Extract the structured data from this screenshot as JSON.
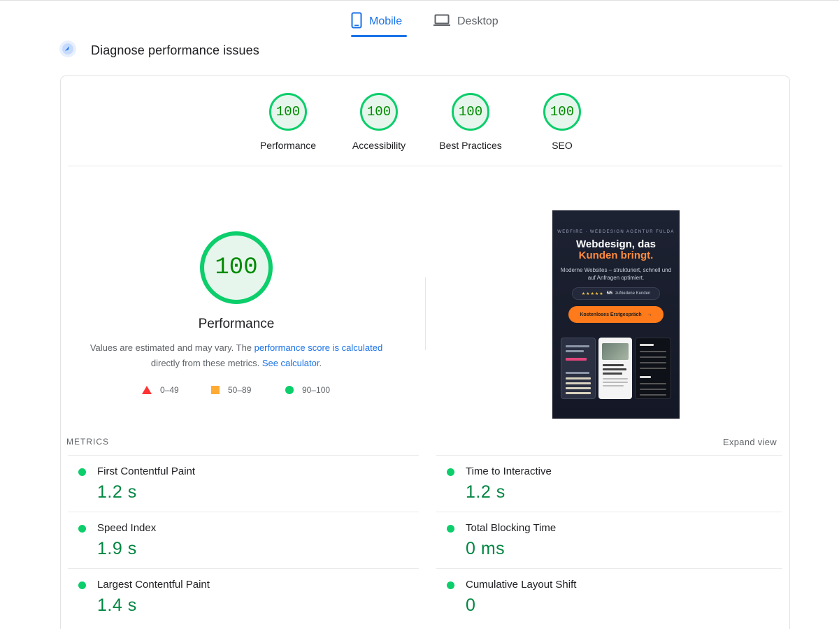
{
  "tabs": [
    {
      "label": "Mobile",
      "icon": "smartphone-icon",
      "active": true
    },
    {
      "label": "Desktop",
      "icon": "laptop-icon",
      "active": false
    }
  ],
  "header": {
    "title": "Diagnose performance issues",
    "icon": "diagnose-icon"
  },
  "gauges": [
    {
      "score": "100",
      "label": "Performance"
    },
    {
      "score": "100",
      "label": "Accessibility"
    },
    {
      "score": "100",
      "label": "Best Practices"
    },
    {
      "score": "100",
      "label": "SEO"
    }
  ],
  "performance": {
    "score": "100",
    "label": "Performance",
    "note_1": "Values are estimated and may vary. The ",
    "note_link_1": "performance score is calculated",
    "note_2": "directly from these metrics. ",
    "note_link_2": "See calculator",
    "note_3": "."
  },
  "legend": [
    {
      "range": "0–49",
      "shape": "triangle",
      "color": "#ff3333"
    },
    {
      "range": "50–89",
      "shape": "square",
      "color": "#ffaa33"
    },
    {
      "range": "90–100",
      "shape": "circle",
      "color": "#0cce6b"
    }
  ],
  "screenshot": {
    "kicker": "WEBFIRE · WEBDESIGN AGENTUR FULDA",
    "headline_1": "Webdesign, das",
    "headline_2": "Kunden bringt.",
    "subline": "Moderne Websites – strukturiert, schnell und auf Anfragen optimiert.",
    "rating_stars": "★★★★★",
    "rating_score": "5/5",
    "rating_text": "zufriedene Kunden",
    "cta": "Kostenloses Erstgespräch",
    "cta_arrow": "→"
  },
  "metrics": {
    "heading": "METRICS",
    "expand_label": "Expand view",
    "left": [
      {
        "name": "First Contentful Paint",
        "value": "1.2 s"
      },
      {
        "name": "Speed Index",
        "value": "1.9 s"
      },
      {
        "name": "Largest Contentful Paint",
        "value": "1.4 s"
      }
    ],
    "right": [
      {
        "name": "Time to Interactive",
        "value": "1.2 s"
      },
      {
        "name": "Total Blocking Time",
        "value": "0 ms"
      },
      {
        "name": "Cumulative Layout Shift",
        "value": "0"
      }
    ]
  },
  "colors": {
    "accent": "#1a73e8",
    "pass": "#0cce6b",
    "pass_text": "#018642",
    "average": "#ffaa33",
    "fail": "#ff3333"
  }
}
